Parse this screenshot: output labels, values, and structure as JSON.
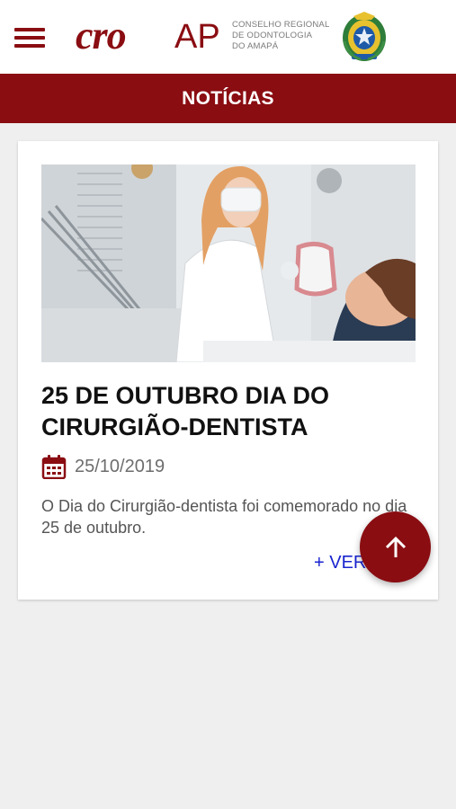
{
  "header": {
    "logo": {
      "brand": "cro",
      "state": "AP",
      "lines": [
        "CONSELHO REGIONAL",
        "DE ODONTOLOGIA",
        "DO AMAPÁ"
      ]
    },
    "icons": {
      "menu": "hamburger-menu-icon",
      "crest": "amapa-coat-of-arms-icon"
    }
  },
  "page": {
    "title": "NOTÍCIAS"
  },
  "news": [
    {
      "image": "dentist-with-patient-photo",
      "title": "25 DE OUTUBRO DIA DO CIRURGIÃO-DENTISTA",
      "date": "25/10/2019",
      "excerpt": "O Dia do Cirurgião-dentista foi comemorado no dia 25 de outubro.",
      "more_label": "+ VER"
    }
  ],
  "fab": {
    "icon": "arrow-up-icon"
  },
  "colors": {
    "brand": "#8a0d12",
    "link": "#1a24cf",
    "background": "#efefef"
  }
}
